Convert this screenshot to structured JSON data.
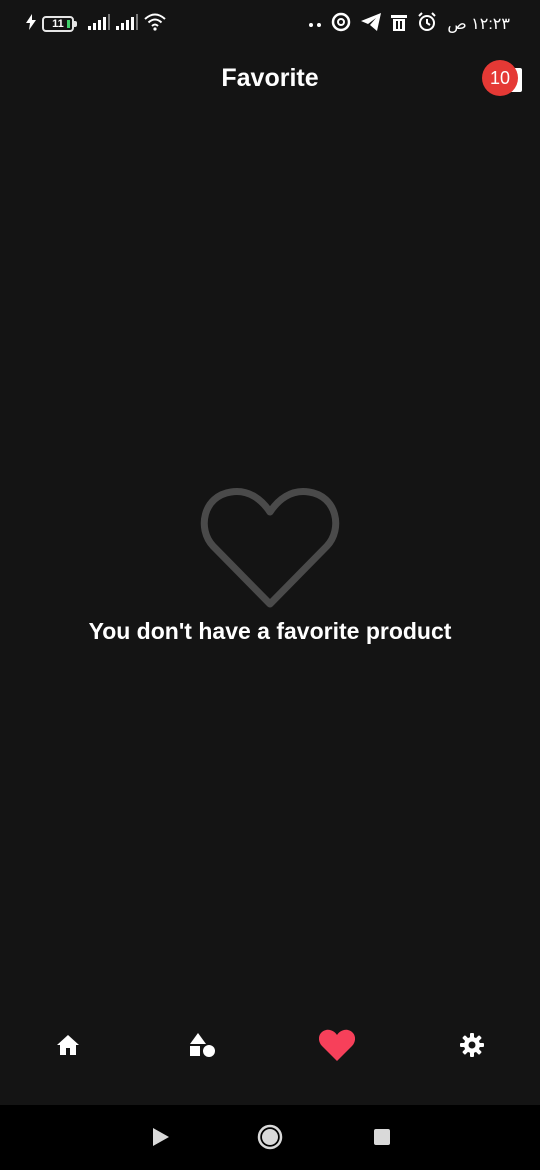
{
  "status_bar": {
    "battery_level": "11",
    "time": "١٢:٢٣ ص",
    "icons": [
      "charging-bolt-icon",
      "battery-icon",
      "signal-icon",
      "signal-icon",
      "wifi-icon",
      "more-dots-icon",
      "at-sign-icon",
      "telegram-icon",
      "trash-icon",
      "alarm-icon"
    ]
  },
  "app_bar": {
    "title": "Favorite",
    "video_badge_count": "10",
    "video_icon": "play-video-icon"
  },
  "empty_state": {
    "icon": "heart-outline-icon",
    "message": "You don't have a favorite product"
  },
  "bottom_nav": {
    "items": [
      {
        "icon": "home-icon",
        "selected": false
      },
      {
        "icon": "categories-icon",
        "selected": false
      },
      {
        "icon": "heart-icon",
        "selected": true
      },
      {
        "icon": "settings-icon",
        "selected": false
      }
    ],
    "active_color": "#f7405a"
  },
  "system_nav": {
    "icons": [
      "back-triangle-icon",
      "home-circle-icon",
      "recents-square-icon"
    ]
  },
  "colors": {
    "background": "#141414",
    "badge": "#e53935",
    "empty_heart_stroke": "#4a4a4a"
  }
}
